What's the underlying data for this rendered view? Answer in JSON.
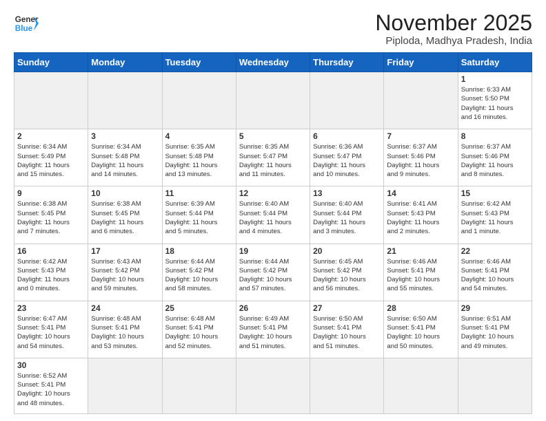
{
  "header": {
    "logo_general": "General",
    "logo_blue": "Blue",
    "month_title": "November 2025",
    "location": "Piploda, Madhya Pradesh, India"
  },
  "weekdays": [
    "Sunday",
    "Monday",
    "Tuesday",
    "Wednesday",
    "Thursday",
    "Friday",
    "Saturday"
  ],
  "weeks": [
    [
      {
        "day": "",
        "info": "",
        "empty": true
      },
      {
        "day": "",
        "info": "",
        "empty": true
      },
      {
        "day": "",
        "info": "",
        "empty": true
      },
      {
        "day": "",
        "info": "",
        "empty": true
      },
      {
        "day": "",
        "info": "",
        "empty": true
      },
      {
        "day": "",
        "info": "",
        "empty": true
      },
      {
        "day": "1",
        "info": "Sunrise: 6:33 AM\nSunset: 5:50 PM\nDaylight: 11 hours\nand 16 minutes.",
        "empty": false
      }
    ],
    [
      {
        "day": "2",
        "info": "Sunrise: 6:34 AM\nSunset: 5:49 PM\nDaylight: 11 hours\nand 15 minutes.",
        "empty": false
      },
      {
        "day": "3",
        "info": "Sunrise: 6:34 AM\nSunset: 5:48 PM\nDaylight: 11 hours\nand 14 minutes.",
        "empty": false
      },
      {
        "day": "4",
        "info": "Sunrise: 6:35 AM\nSunset: 5:48 PM\nDaylight: 11 hours\nand 13 minutes.",
        "empty": false
      },
      {
        "day": "5",
        "info": "Sunrise: 6:35 AM\nSunset: 5:47 PM\nDaylight: 11 hours\nand 11 minutes.",
        "empty": false
      },
      {
        "day": "6",
        "info": "Sunrise: 6:36 AM\nSunset: 5:47 PM\nDaylight: 11 hours\nand 10 minutes.",
        "empty": false
      },
      {
        "day": "7",
        "info": "Sunrise: 6:37 AM\nSunset: 5:46 PM\nDaylight: 11 hours\nand 9 minutes.",
        "empty": false
      },
      {
        "day": "8",
        "info": "Sunrise: 6:37 AM\nSunset: 5:46 PM\nDaylight: 11 hours\nand 8 minutes.",
        "empty": false
      }
    ],
    [
      {
        "day": "9",
        "info": "Sunrise: 6:38 AM\nSunset: 5:45 PM\nDaylight: 11 hours\nand 7 minutes.",
        "empty": false
      },
      {
        "day": "10",
        "info": "Sunrise: 6:38 AM\nSunset: 5:45 PM\nDaylight: 11 hours\nand 6 minutes.",
        "empty": false
      },
      {
        "day": "11",
        "info": "Sunrise: 6:39 AM\nSunset: 5:44 PM\nDaylight: 11 hours\nand 5 minutes.",
        "empty": false
      },
      {
        "day": "12",
        "info": "Sunrise: 6:40 AM\nSunset: 5:44 PM\nDaylight: 11 hours\nand 4 minutes.",
        "empty": false
      },
      {
        "day": "13",
        "info": "Sunrise: 6:40 AM\nSunset: 5:44 PM\nDaylight: 11 hours\nand 3 minutes.",
        "empty": false
      },
      {
        "day": "14",
        "info": "Sunrise: 6:41 AM\nSunset: 5:43 PM\nDaylight: 11 hours\nand 2 minutes.",
        "empty": false
      },
      {
        "day": "15",
        "info": "Sunrise: 6:42 AM\nSunset: 5:43 PM\nDaylight: 11 hours\nand 1 minute.",
        "empty": false
      }
    ],
    [
      {
        "day": "16",
        "info": "Sunrise: 6:42 AM\nSunset: 5:43 PM\nDaylight: 11 hours\nand 0 minutes.",
        "empty": false
      },
      {
        "day": "17",
        "info": "Sunrise: 6:43 AM\nSunset: 5:42 PM\nDaylight: 10 hours\nand 59 minutes.",
        "empty": false
      },
      {
        "day": "18",
        "info": "Sunrise: 6:44 AM\nSunset: 5:42 PM\nDaylight: 10 hours\nand 58 minutes.",
        "empty": false
      },
      {
        "day": "19",
        "info": "Sunrise: 6:44 AM\nSunset: 5:42 PM\nDaylight: 10 hours\nand 57 minutes.",
        "empty": false
      },
      {
        "day": "20",
        "info": "Sunrise: 6:45 AM\nSunset: 5:42 PM\nDaylight: 10 hours\nand 56 minutes.",
        "empty": false
      },
      {
        "day": "21",
        "info": "Sunrise: 6:46 AM\nSunset: 5:41 PM\nDaylight: 10 hours\nand 55 minutes.",
        "empty": false
      },
      {
        "day": "22",
        "info": "Sunrise: 6:46 AM\nSunset: 5:41 PM\nDaylight: 10 hours\nand 54 minutes.",
        "empty": false
      }
    ],
    [
      {
        "day": "23",
        "info": "Sunrise: 6:47 AM\nSunset: 5:41 PM\nDaylight: 10 hours\nand 54 minutes.",
        "empty": false
      },
      {
        "day": "24",
        "info": "Sunrise: 6:48 AM\nSunset: 5:41 PM\nDaylight: 10 hours\nand 53 minutes.",
        "empty": false
      },
      {
        "day": "25",
        "info": "Sunrise: 6:48 AM\nSunset: 5:41 PM\nDaylight: 10 hours\nand 52 minutes.",
        "empty": false
      },
      {
        "day": "26",
        "info": "Sunrise: 6:49 AM\nSunset: 5:41 PM\nDaylight: 10 hours\nand 51 minutes.",
        "empty": false
      },
      {
        "day": "27",
        "info": "Sunrise: 6:50 AM\nSunset: 5:41 PM\nDaylight: 10 hours\nand 51 minutes.",
        "empty": false
      },
      {
        "day": "28",
        "info": "Sunrise: 6:50 AM\nSunset: 5:41 PM\nDaylight: 10 hours\nand 50 minutes.",
        "empty": false
      },
      {
        "day": "29",
        "info": "Sunrise: 6:51 AM\nSunset: 5:41 PM\nDaylight: 10 hours\nand 49 minutes.",
        "empty": false
      }
    ],
    [
      {
        "day": "30",
        "info": "Sunrise: 6:52 AM\nSunset: 5:41 PM\nDaylight: 10 hours\nand 48 minutes.",
        "empty": false,
        "last": true
      },
      {
        "day": "",
        "info": "",
        "empty": true,
        "last": true
      },
      {
        "day": "",
        "info": "",
        "empty": true,
        "last": true
      },
      {
        "day": "",
        "info": "",
        "empty": true,
        "last": true
      },
      {
        "day": "",
        "info": "",
        "empty": true,
        "last": true
      },
      {
        "day": "",
        "info": "",
        "empty": true,
        "last": true
      },
      {
        "day": "",
        "info": "",
        "empty": true,
        "last": true
      }
    ]
  ]
}
